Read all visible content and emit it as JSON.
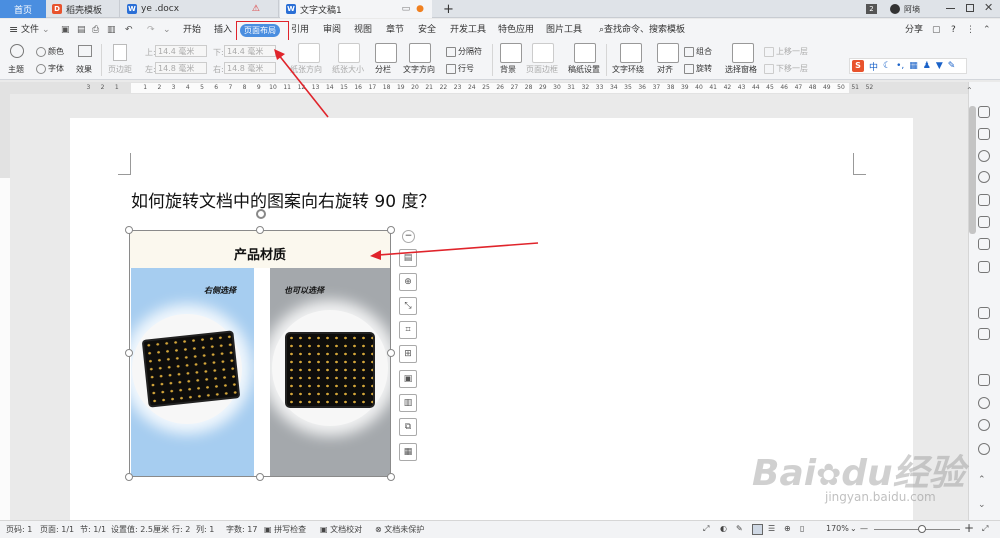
{
  "tabs": [
    {
      "label": "首页",
      "icon": "",
      "active": false,
      "home": true
    },
    {
      "label": "稻壳模板",
      "icon": "D",
      "icolor": "#e8532d"
    },
    {
      "label": "ye .docx",
      "icon": "W",
      "icolor": "#2b6fd6"
    },
    {
      "label": "文字文稿1",
      "icon": "W",
      "icolor": "#2b6fd6",
      "current": true
    }
  ],
  "titlebar": {
    "user": "阿墒",
    "badge": "2",
    "new_tab": "+"
  },
  "menu": {
    "file": "文件",
    "items": [
      "开始",
      "插入",
      "页面布局",
      "引用",
      "审阅",
      "视图",
      "章节",
      "安全",
      "开发工具",
      "特色应用",
      "图片工具"
    ],
    "search": "查找命令、搜索模板",
    "share": "分享",
    "help": "?"
  },
  "ribbon": {
    "theme": "主题",
    "colors": "颜色",
    "font": "字体",
    "effects": "效果",
    "margins": "页边距",
    "top": "上:",
    "top_val": "14.4 毫米",
    "bottom": "下:",
    "bottom_val": "14.4 毫米",
    "left": "左:",
    "left_val": "14.8 毫米",
    "right": "右:",
    "right_val": "14.8 毫米",
    "orientation": "纸张方向",
    "paper_size": "纸张大小",
    "columns": "分栏",
    "text_dir": "文字方向",
    "separator": "分隔符",
    "line_num": "行号",
    "background": "背景",
    "page_border": "页面边框",
    "paper_setup": "稿纸设置",
    "wrap": "文字环绕",
    "align": "对齐",
    "group": "组合",
    "rotate": "旋转",
    "selection_pane": "选择窗格",
    "bring_forward": "上移一层",
    "send_backward": "下移一层"
  },
  "ruler_labels": [
    "3",
    "2",
    "1",
    "",
    "1",
    "2",
    "3",
    "4",
    "5",
    "6",
    "7",
    "8",
    "9",
    "10",
    "11",
    "12",
    "13",
    "14",
    "15",
    "16",
    "17",
    "18",
    "19",
    "20",
    "21",
    "22",
    "23",
    "24",
    "25",
    "26",
    "27",
    "28",
    "29",
    "30",
    "31",
    "32",
    "33",
    "34",
    "35",
    "36",
    "37",
    "38",
    "39",
    "40",
    "41",
    "42",
    "43",
    "44",
    "45",
    "46",
    "47",
    "48",
    "49",
    "50",
    "51",
    "52"
  ],
  "document": {
    "question": "如何旋转文档中的图案向右旋转 90 度？",
    "image_title": "产品材质",
    "left_caption": "右侧选择",
    "right_caption": "也可以选择"
  },
  "ime": {
    "logo": "S",
    "text": "中"
  },
  "watermark": {
    "brand": "Bai",
    "brand2": "du",
    "brand3": "经验",
    "url": "jingyan.baidu.com"
  },
  "status": {
    "page": "页码: 1",
    "pages": "页面: 1/1",
    "section": "节: 1/1",
    "setting": "设置值: 2.5厘米",
    "row": "行: 2",
    "col": "列: 1",
    "words": "字数: 17",
    "spell": "拼写检查",
    "proof": "文档校对",
    "protect": "文档未保护",
    "zoom": "170%",
    "minus": "—",
    "plus": "+"
  },
  "colors": {
    "accent": "#4a8ee0",
    "tab_home": "#4a8ee0",
    "arrow": "#e0242b",
    "highlight": "#e0242b"
  }
}
